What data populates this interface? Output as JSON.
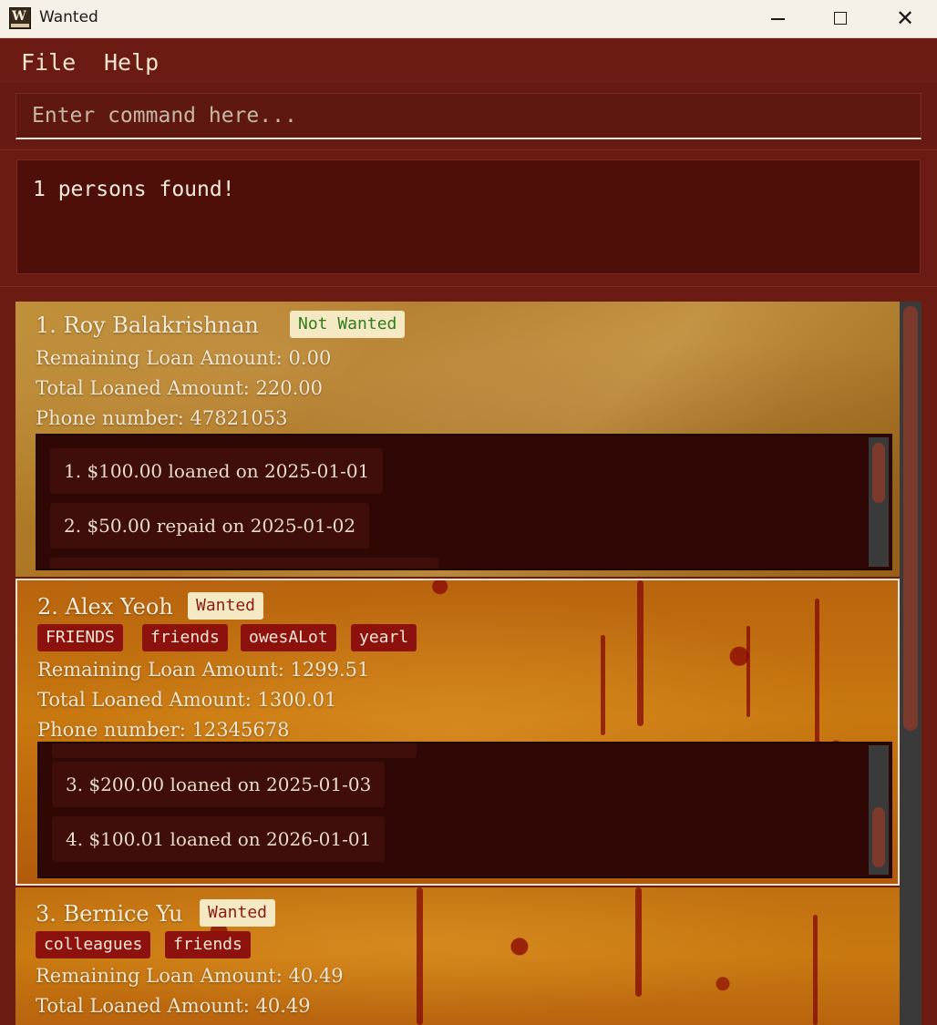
{
  "window": {
    "title": "Wanted",
    "icon": "wanted-list-app-icon",
    "icon_glyph": "W"
  },
  "menu": {
    "items": [
      {
        "label": "File"
      },
      {
        "label": "Help"
      }
    ]
  },
  "command": {
    "placeholder": "Enter command here...",
    "value": ""
  },
  "result": {
    "text": "1 persons found!"
  },
  "colors": {
    "background": "#6b1b12",
    "tag": "#8d120d",
    "status_wanted": "#8c1a10",
    "status_not_wanted": "#2f7a1a"
  },
  "persons": [
    {
      "index": "1.",
      "name": "Roy Balakrishnan",
      "status": "Not Wanted",
      "tags": [],
      "remaining": "Remaining Loan Amount: 0.00",
      "total": "Total Loaned Amount: 220.00",
      "phone": "Phone number: 47821053",
      "loans": [
        "1. $100.00 loaned on 2025-01-01",
        "2. $50.00 repaid on 2025-01-02"
      ]
    },
    {
      "index": "2.",
      "name": "Alex Yeoh",
      "status": "Wanted",
      "tags": [
        "FRIENDS",
        "friends",
        "owesALot",
        "yearl"
      ],
      "remaining": "Remaining Loan Amount: 1299.51",
      "total": "Total Loaned Amount: 1300.01",
      "phone": "Phone number: 12345678",
      "loans": [
        "3. $200.00 loaned on 2025-01-03",
        "4. $100.01 loaned on 2026-01-01"
      ]
    },
    {
      "index": "3.",
      "name": "Bernice Yu",
      "status": "Wanted",
      "tags": [
        "colleagues",
        "friends"
      ],
      "remaining": "Remaining Loan Amount: 40.49",
      "total": "Total Loaned Amount: 40.49"
    }
  ]
}
